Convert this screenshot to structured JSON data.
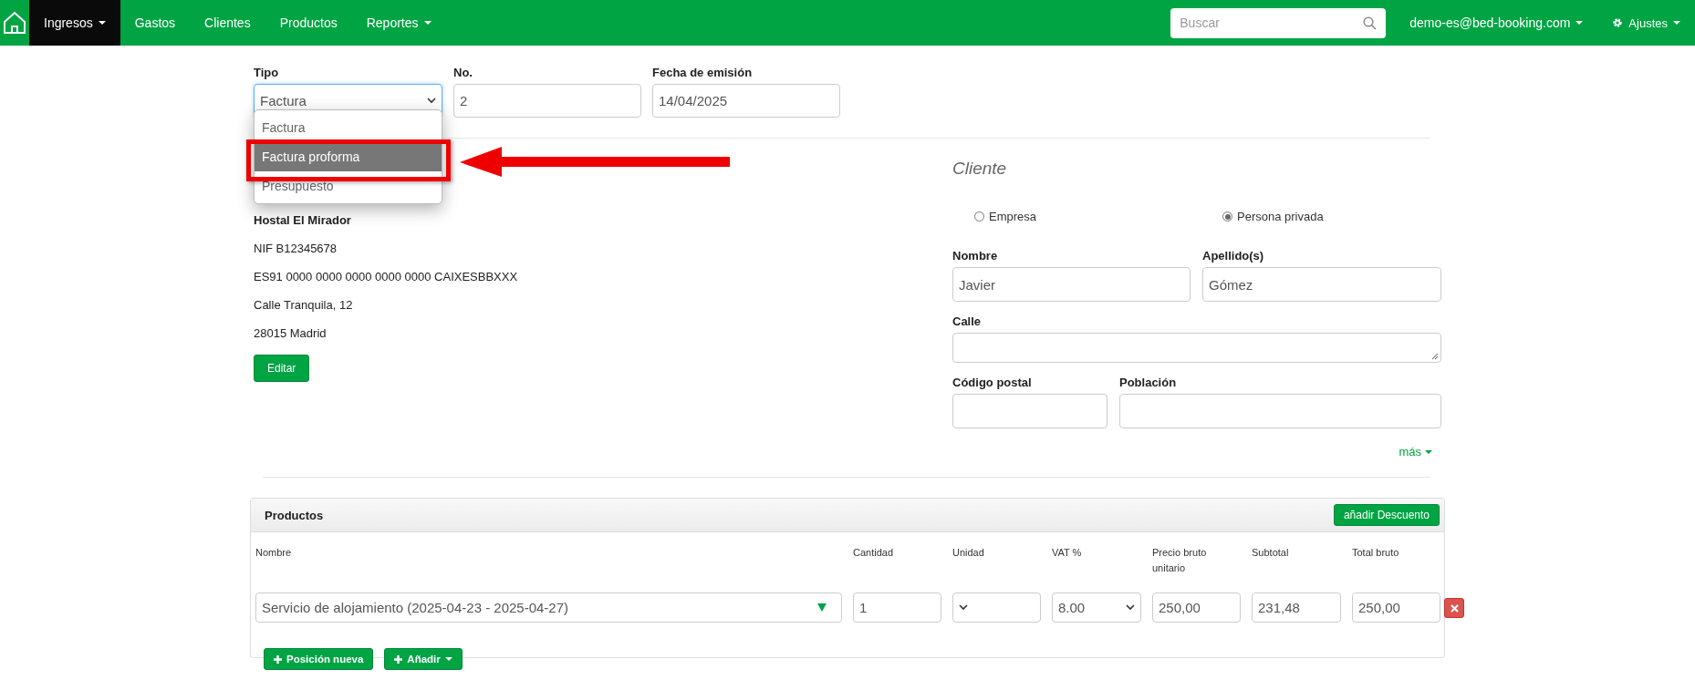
{
  "navbar": {
    "items": [
      {
        "label": "Ingresos",
        "caret": true,
        "selected": true
      },
      {
        "label": "Gastos",
        "caret": false,
        "selected": false
      },
      {
        "label": "Clientes",
        "caret": false,
        "selected": false
      },
      {
        "label": "Productos",
        "caret": false,
        "selected": false
      },
      {
        "label": "Reportes",
        "caret": true,
        "selected": false
      }
    ],
    "search": {
      "placeholder": "Buscar"
    },
    "user": "demo-es@bed-booking.com",
    "settings": "Ajustes"
  },
  "document": {
    "tipo": {
      "label": "Tipo",
      "value": "Factura",
      "options": [
        {
          "label": "Factura",
          "highlighted": false
        },
        {
          "label": "Factura proforma",
          "highlighted": true
        },
        {
          "label": "Presupuesto",
          "highlighted": false
        }
      ]
    },
    "number": {
      "label": "No.",
      "value": "2"
    },
    "date": {
      "label": "Fecha de emisión",
      "value": "14/04/2025"
    }
  },
  "issuer": {
    "lines": [
      "Hostal El Mirador",
      "NIF B12345678",
      "ES91 0000 0000 0000 0000 0000 CAIXESBBXXX",
      "Calle Tranquila, 12",
      "28015 Madrid"
    ],
    "edit_button": "Editar"
  },
  "client": {
    "title": "Cliente",
    "types": [
      {
        "label": "Empresa",
        "selected": false
      },
      {
        "label": "Persona privada",
        "selected": true
      }
    ],
    "fields": [
      {
        "label": "Nombre",
        "value": "Javier",
        "kind": "input"
      },
      {
        "label": "Apellido(s)",
        "value": "Gómez",
        "kind": "input"
      },
      {
        "label": "Calle",
        "kind": "textarea"
      },
      {
        "label": "Código postal",
        "kind": "input"
      },
      {
        "label": "Población",
        "kind": "input"
      }
    ],
    "more_link": "más"
  },
  "products": {
    "title": "Productos",
    "discount_button": "añadir Descuento",
    "columns": [
      "Nombre",
      "Cantidad",
      "Unidad",
      "VAT %",
      "Precio bruto unitario",
      "Subtotal",
      "Total bruto"
    ],
    "rows": [
      {
        "name": "Servicio de alojamiento (2025-04-23 - 2025-04-27)",
        "quantity": "1",
        "unit": "",
        "vat": "8.00",
        "unit_price": "250,00",
        "subtotal": "231,48",
        "total": "250,00"
      }
    ],
    "buttons": [
      {
        "label": "Posición nueva",
        "caret": false
      },
      {
        "label": "Añadir",
        "caret": true
      }
    ]
  }
}
